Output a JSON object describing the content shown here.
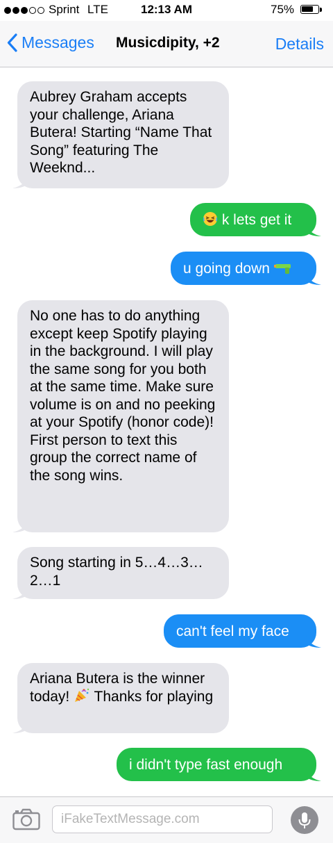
{
  "status_bar": {
    "carrier": "Sprint",
    "network": "LTE",
    "time": "12:13 AM",
    "battery_percent": "75%",
    "battery_level": 0.75,
    "signal_bars": 3,
    "signal_total": 5
  },
  "nav": {
    "back_label": "Messages",
    "title": "Musicdipity, +2",
    "details_label": "Details"
  },
  "messages": [
    {
      "direction": "incoming",
      "text": "Aubrey Graham accepts your challenge, Ariana Butera! Starting “Name That Song” featuring The Weeknd..."
    },
    {
      "direction": "outgoing",
      "color": "green",
      "emoji": "laughing-face",
      "text": "k lets get it"
    },
    {
      "direction": "outgoing",
      "color": "blue",
      "text": "u going down",
      "emoji_after": "water-pistol"
    },
    {
      "direction": "incoming",
      "text": "No one has to do anything except keep Spotify playing in the background. I will play the same song for you both at the same time. Make sure volume is on and no peeking at your Spotify (honor code)! First person to text this group the correct name of the song wins."
    },
    {
      "direction": "incoming",
      "text": "Song starting in 5…4…3…2…1"
    },
    {
      "direction": "outgoing",
      "color": "blue",
      "text": "can't feel my face"
    },
    {
      "direction": "incoming",
      "text_before": "Ariana Butera is the winner today!",
      "emoji": "party-popper",
      "text_after": "Thanks for playing"
    },
    {
      "direction": "outgoing",
      "color": "green",
      "text": "i didn't type fast enough"
    }
  ],
  "input_bar": {
    "placeholder": "iFakeTextMessage.com"
  },
  "colors": {
    "accent": "#1a7ef6",
    "imessage_blue": "#1b8ef5",
    "sms_green": "#23c04a",
    "incoming_gray": "#e5e5ea"
  }
}
